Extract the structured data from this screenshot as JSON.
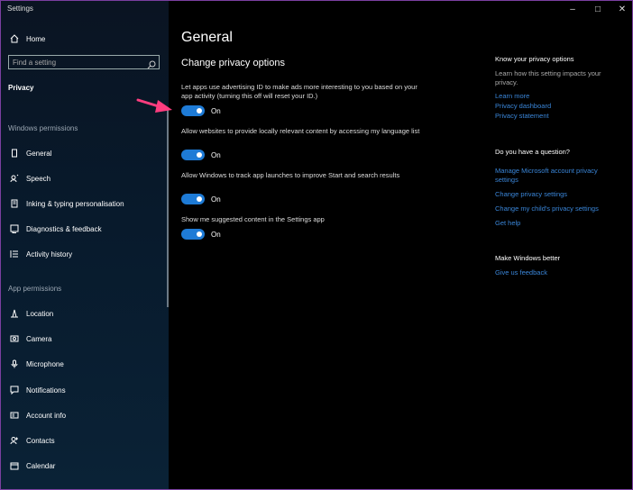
{
  "window": {
    "title": "Settings",
    "min_icon": "minimize-icon",
    "max_icon": "maximize-icon",
    "close_icon": "close-icon"
  },
  "sidebar": {
    "home": "Home",
    "search_placeholder": "Find a setting",
    "current_section": "Privacy",
    "windows_permissions_label": "Windows permissions",
    "windows_items": [
      {
        "label": "General",
        "icon": "general-icon"
      },
      {
        "label": "Speech",
        "icon": "speech-icon"
      },
      {
        "label": "Inking & typing personalisation",
        "icon": "inking-icon"
      },
      {
        "label": "Diagnostics & feedback",
        "icon": "diagnostics-icon"
      },
      {
        "label": "Activity history",
        "icon": "activity-icon"
      }
    ],
    "app_permissions_label": "App permissions",
    "app_items": [
      {
        "label": "Location",
        "icon": "location-icon"
      },
      {
        "label": "Camera",
        "icon": "camera-icon"
      },
      {
        "label": "Microphone",
        "icon": "microphone-icon"
      },
      {
        "label": "Notifications",
        "icon": "notifications-icon"
      },
      {
        "label": "Account info",
        "icon": "account-icon"
      },
      {
        "label": "Contacts",
        "icon": "contacts-icon"
      },
      {
        "label": "Calendar",
        "icon": "calendar-icon"
      }
    ]
  },
  "main": {
    "title": "General",
    "subtitle": "Change privacy options",
    "options": [
      {
        "text": "Let apps use advertising ID to make ads more interesting to you based on your app activity (turning this off will reset your ID.)",
        "state": "On"
      },
      {
        "text": "Allow websites to provide locally relevant content by accessing my language list",
        "state": "On"
      },
      {
        "text": "Allow Windows to track app launches to improve Start and search results",
        "state": "On"
      },
      {
        "text": "Show me suggested content in the Settings app",
        "state": "On"
      }
    ]
  },
  "right": {
    "know_title": "Know your privacy options",
    "know_text": "Learn how this setting impacts your privacy.",
    "know_links": [
      "Learn more",
      "Privacy dashboard",
      "Privacy statement"
    ],
    "question_title": "Do you have a question?",
    "question_links": [
      "Manage Microsoft account privacy settings",
      "Change privacy settings",
      "Change my child's privacy settings",
      "Get help"
    ],
    "better_title": "Make Windows better",
    "better_link": "Give us feedback"
  },
  "colors": {
    "accent": "#1e7bd6",
    "link": "#3a86d9",
    "annotation_arrow": "#ff3d7f"
  }
}
